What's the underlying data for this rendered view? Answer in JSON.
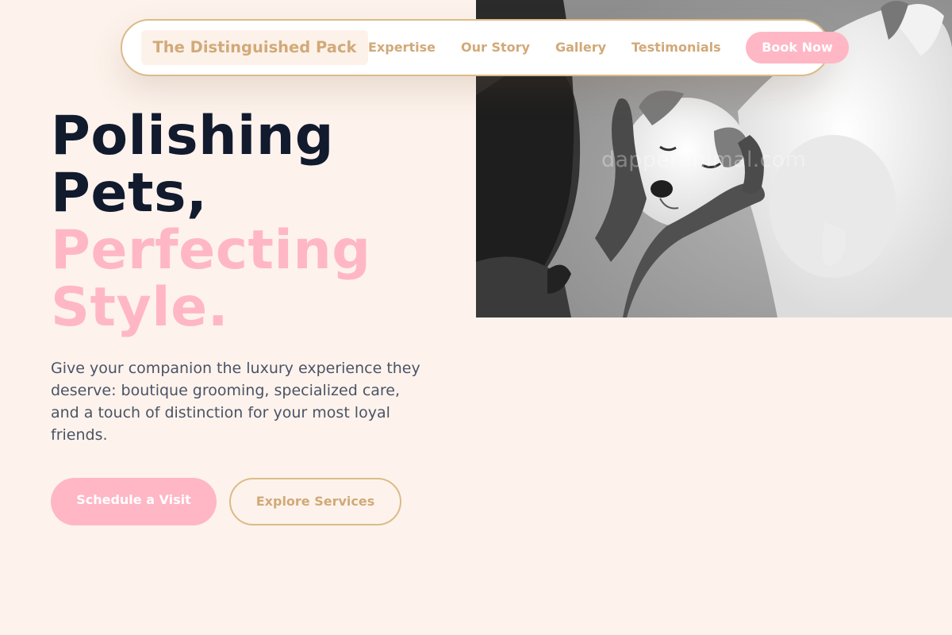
{
  "nav": {
    "brand": "The Distinguished Pack",
    "links": [
      "Expertise",
      "Our Story",
      "Gallery",
      "Testimonials"
    ],
    "cta": "Book Now"
  },
  "hero": {
    "headline_line1": "Polishing",
    "headline_line2": "Pets,",
    "headline_line3": "Perfecting",
    "headline_line4": "Style.",
    "subtitle": "Give your companion the luxury experience they deserve: boutique grooming, specialized care, and a touch of distinction for your most loyal friends.",
    "primary_cta": "Schedule a Visit",
    "secondary_cta": "Explore Services"
  },
  "image": {
    "watermark": "dapperanimal.com",
    "icon": "puppy-photo"
  },
  "colors": {
    "background": "#fdf3ec",
    "accent_pink": "#ffb7c5",
    "accent_gold": "#d2a978",
    "heading_dark": "#121a2e",
    "body_text": "#4a5366"
  }
}
